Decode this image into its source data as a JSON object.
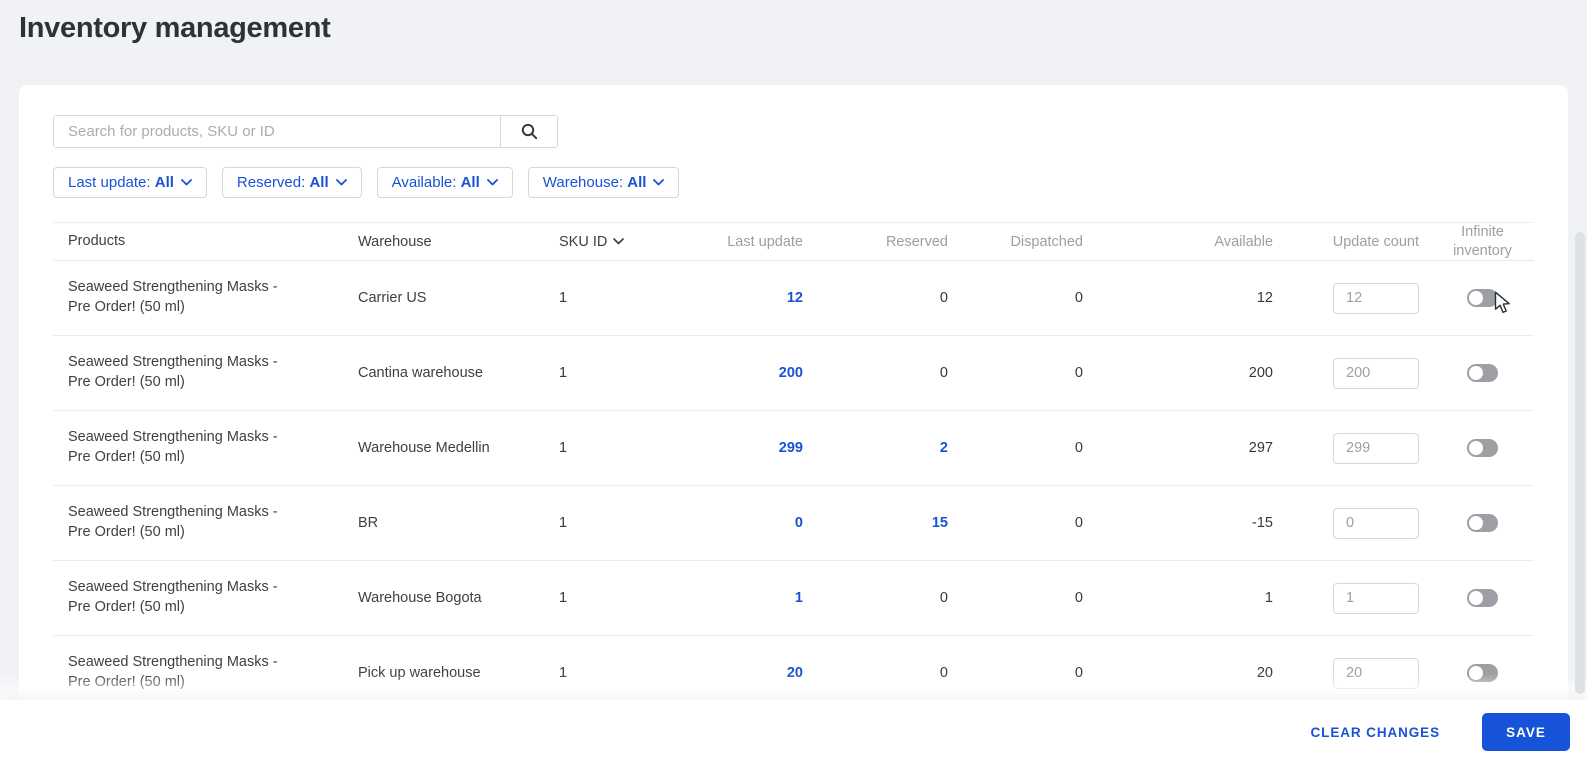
{
  "page": {
    "title": "Inventory management"
  },
  "search": {
    "placeholder": "Search for products, SKU or ID",
    "icon": "search-icon"
  },
  "filters": [
    {
      "label": "Last update:",
      "value": "All"
    },
    {
      "label": "Reserved:",
      "value": "All"
    },
    {
      "label": "Available:",
      "value": "All"
    },
    {
      "label": "Warehouse:",
      "value": "All"
    }
  ],
  "table": {
    "columns": [
      "Products",
      "Warehouse",
      "SKU ID",
      "Last update",
      "Reserved",
      "Dispatched",
      "Available",
      "Update count",
      "Infinite inventory"
    ],
    "sorted_column": "SKU ID",
    "rows": [
      {
        "product": "Seaweed Strengthening Masks - Pre Order! (50 ml)",
        "warehouse": "Carrier US",
        "sku_id": "1",
        "last_update": "12",
        "reserved": "0",
        "dispatched": "0",
        "available": "12",
        "update_count": "12",
        "infinite_inventory": "off"
      },
      {
        "product": "Seaweed Strengthening Masks - Pre Order! (50 ml)",
        "warehouse": "Cantina warehouse",
        "sku_id": "1",
        "last_update": "200",
        "reserved": "0",
        "dispatched": "0",
        "available": "200",
        "update_count": "200",
        "infinite_inventory": "off"
      },
      {
        "product": "Seaweed Strengthening Masks - Pre Order! (50 ml)",
        "warehouse": "Warehouse Medellin",
        "sku_id": "1",
        "last_update": "299",
        "reserved": "2",
        "dispatched": "0",
        "available": "297",
        "update_count": "299",
        "infinite_inventory": "off"
      },
      {
        "product": "Seaweed Strengthening Masks - Pre Order! (50 ml)",
        "warehouse": "BR",
        "sku_id": "1",
        "last_update": "0",
        "reserved": "15",
        "dispatched": "0",
        "available": "-15",
        "update_count": "0",
        "infinite_inventory": "off"
      },
      {
        "product": "Seaweed Strengthening Masks - Pre Order! (50 ml)",
        "warehouse": "Warehouse Bogota",
        "sku_id": "1",
        "last_update": "1",
        "reserved": "0",
        "dispatched": "0",
        "available": "1",
        "update_count": "1",
        "infinite_inventory": "off"
      },
      {
        "product": "Seaweed Strengthening Masks - Pre Order! (50 ml)",
        "warehouse": "Pick up warehouse",
        "sku_id": "1",
        "last_update": "20",
        "reserved": "0",
        "dispatched": "0",
        "available": "20",
        "update_count": "20",
        "infinite_inventory": "off"
      }
    ]
  },
  "footer": {
    "clear_changes_label": "CLEAR CHANGES",
    "save_label": "SAVE"
  },
  "colors": {
    "accent_blue": "#1a52d6",
    "save_button_blue": "#1653d9",
    "page_background": "#f0f2f5",
    "muted_text": "#9ba0a6",
    "dark_text": "#2d3237",
    "toggle_off_gray": "#9c9fa4"
  }
}
